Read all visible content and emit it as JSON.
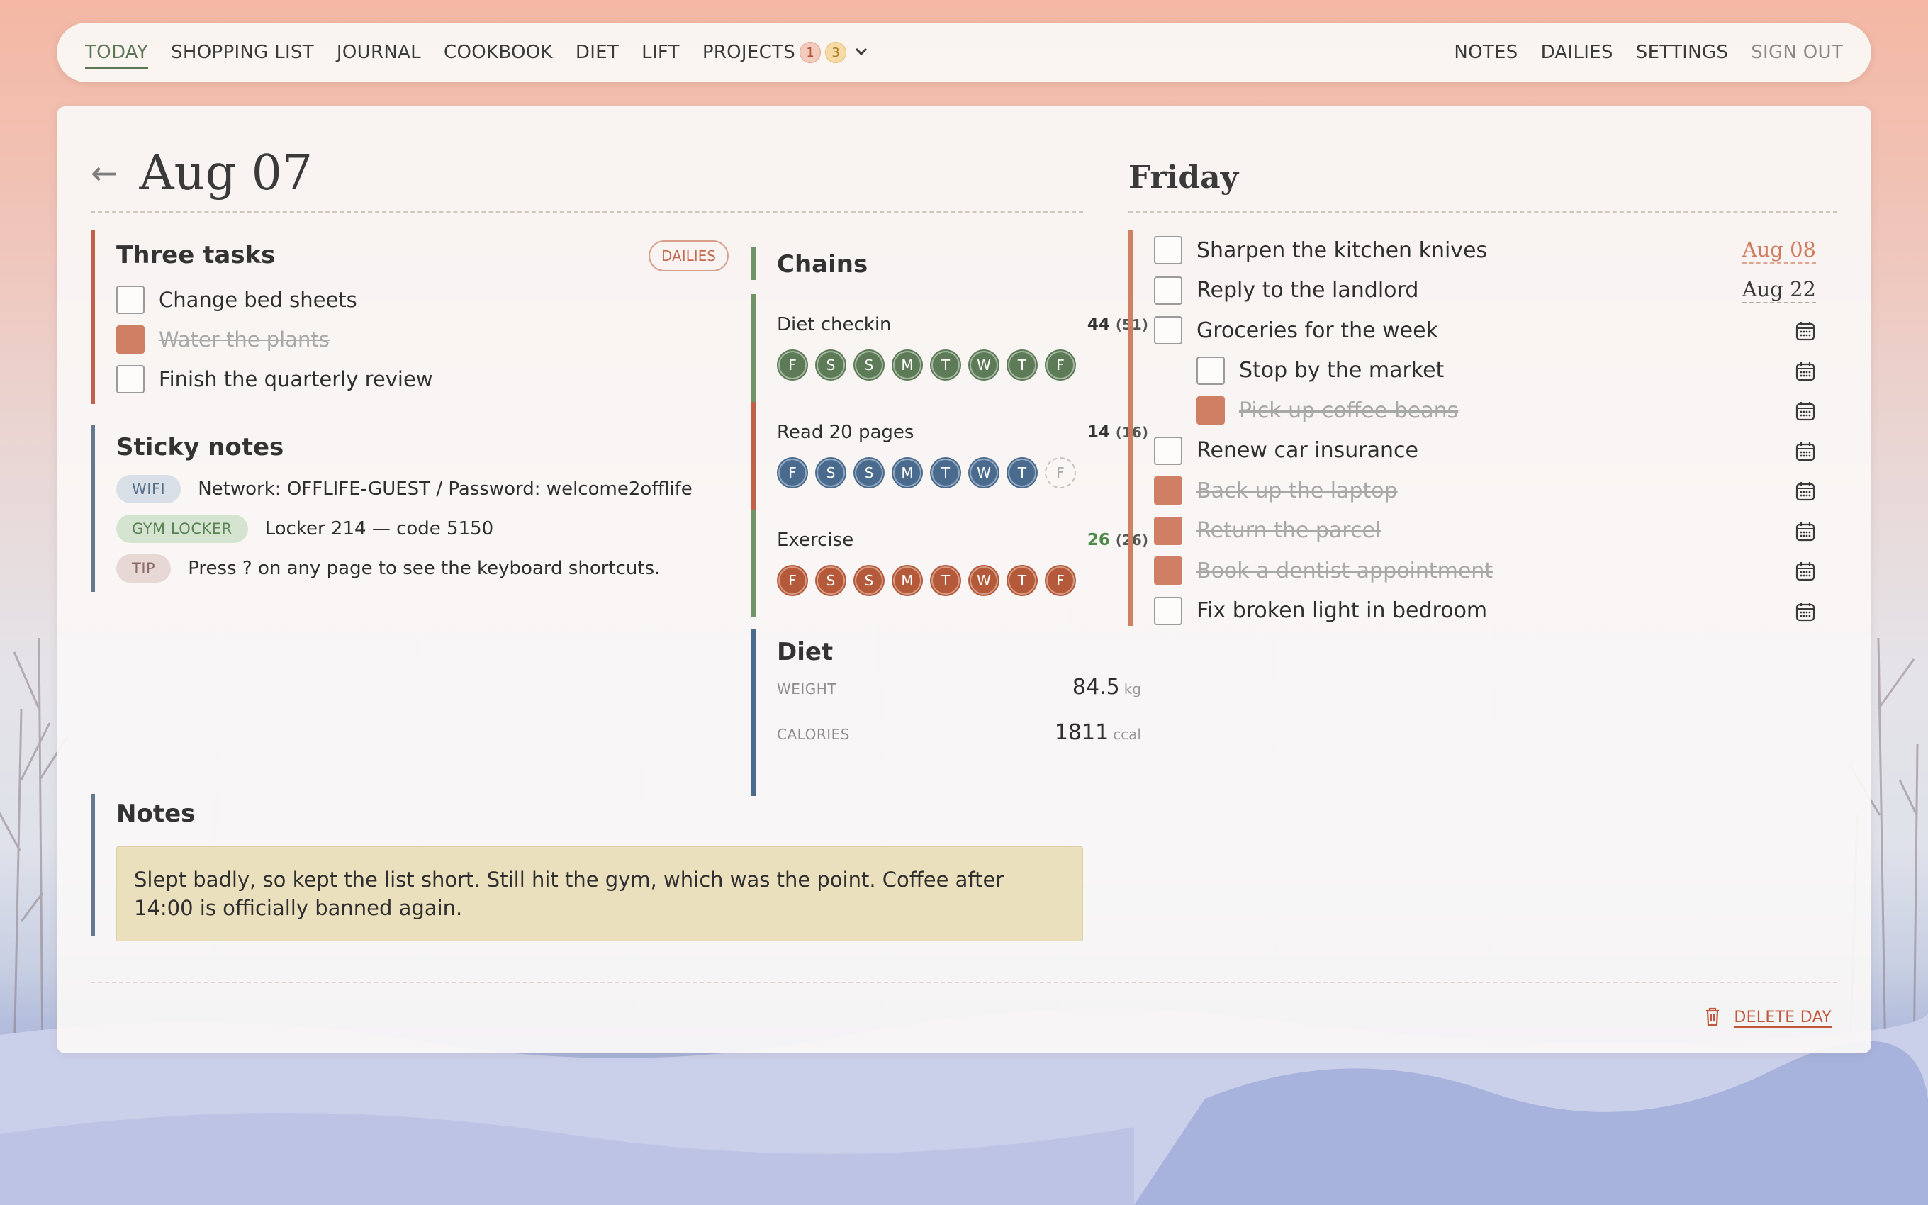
{
  "colors": {
    "accent_green": "#5b7654",
    "accent_rust": "#cf7f63",
    "bar_red": "#c2604a",
    "bar_slate": "#66788f",
    "bar_green": "#6e9468",
    "bar_blue": "#4a6b8e",
    "bar_orange": "#d08260",
    "note_bg": "#ebe0bd"
  },
  "nav": {
    "left": [
      {
        "label": "TODAY",
        "active": true
      },
      {
        "label": "SHOPPING LIST"
      },
      {
        "label": "JOURNAL"
      },
      {
        "label": "COOKBOOK"
      },
      {
        "label": "DIET"
      },
      {
        "label": "LIFT"
      },
      {
        "label": "PROJECTS"
      }
    ],
    "projects_badges": [
      "1",
      "3"
    ],
    "right": [
      {
        "label": "NOTES"
      },
      {
        "label": "DAILIES"
      },
      {
        "label": "SETTINGS"
      },
      {
        "label": "SIGN OUT"
      }
    ]
  },
  "header": {
    "back_icon": "←",
    "date": "Aug 07",
    "weekday": "Friday"
  },
  "three_tasks": {
    "title": "Three tasks",
    "dailies_label": "DAILIES",
    "items": [
      {
        "label": "Change bed sheets",
        "done": false
      },
      {
        "label": "Water the plants",
        "done": true
      },
      {
        "label": "Finish the quarterly review",
        "done": false
      }
    ]
  },
  "sticky_notes": {
    "title": "Sticky notes",
    "items": [
      {
        "tag": "WIFI",
        "text": "Network: OFFLIFE-GUEST / Password: welcome2offlife"
      },
      {
        "tag": "GYM LOCKER",
        "text": "Locker 214 — code 5150"
      },
      {
        "tag": "TIP",
        "text": "Press ? on any page to see the keyboard shortcuts."
      }
    ]
  },
  "chains": {
    "title": "Chains",
    "items": [
      {
        "name": "Diet checkin",
        "count": "44",
        "max": "(51)",
        "days": [
          "F",
          "S",
          "S",
          "M",
          "T",
          "W",
          "T",
          "F"
        ],
        "done": [
          true,
          true,
          true,
          true,
          true,
          true,
          true,
          true
        ]
      },
      {
        "name": "Read 20 pages",
        "count": "14",
        "max": "(16)",
        "days": [
          "F",
          "S",
          "S",
          "M",
          "T",
          "W",
          "T",
          "F"
        ],
        "done": [
          true,
          true,
          true,
          true,
          true,
          true,
          true,
          false
        ]
      },
      {
        "name": "Exercise",
        "count": "26",
        "max": "(26)",
        "days": [
          "F",
          "S",
          "S",
          "M",
          "T",
          "W",
          "T",
          "F"
        ],
        "done": [
          true,
          true,
          true,
          true,
          true,
          true,
          true,
          true
        ]
      }
    ]
  },
  "diet": {
    "title": "Diet",
    "weight_label": "WEIGHT",
    "weight_value": "84.5",
    "weight_unit": "kg",
    "calories_label": "CALORIES",
    "calories_value": "1811",
    "calories_unit": "ccal"
  },
  "notes": {
    "title": "Notes",
    "text": "Slept badly, so kept the list short. Still hit the gym, which was the point. Coffee after 14:00 is officially banned again."
  },
  "friday_tasks": [
    {
      "label": "Sharpen the kitchen knives",
      "done": false,
      "due": "Aug 08",
      "due_soon": true
    },
    {
      "label": "Reply to the landlord",
      "done": false,
      "due": "Aug 22"
    },
    {
      "label": "Groceries for the week",
      "done": false
    },
    {
      "label": "Stop by the market",
      "done": false,
      "sub": true
    },
    {
      "label": "Pick up coffee beans",
      "done": true,
      "sub": true
    },
    {
      "label": "Renew car insurance",
      "done": false
    },
    {
      "label": "Back up the laptop",
      "done": true
    },
    {
      "label": "Return the parcel",
      "done": true
    },
    {
      "label": "Book a dentist appointment",
      "done": true
    },
    {
      "label": "Fix broken light in bedroom",
      "done": false
    }
  ],
  "footer": {
    "delete_label": "DELETE DAY"
  }
}
